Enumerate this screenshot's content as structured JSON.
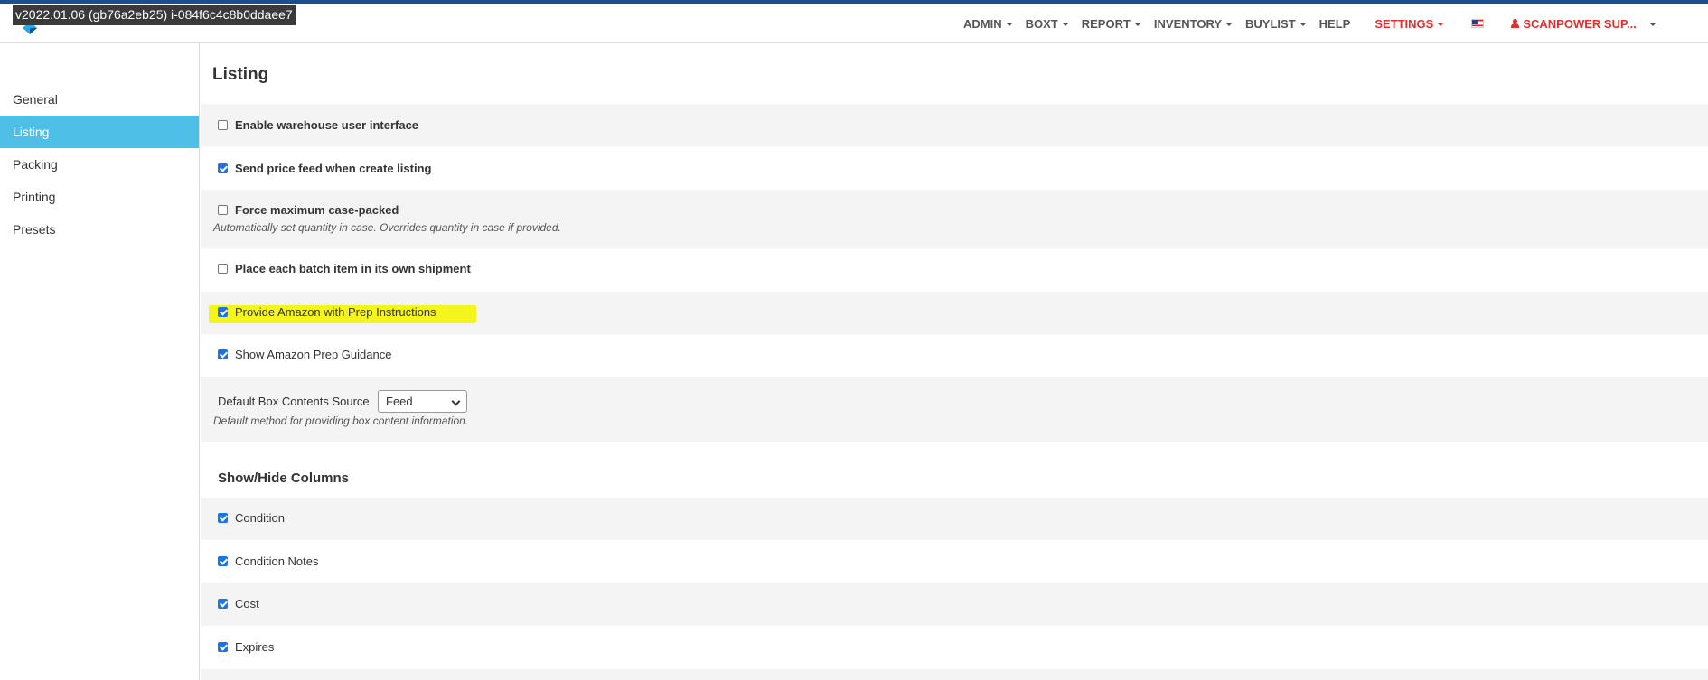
{
  "app": {
    "version": "v2022.01.06 (gb76a2eb25) i-084f6c4c8b0ddaee7"
  },
  "nav": {
    "items": [
      {
        "label": "ADMIN",
        "dropdown": true
      },
      {
        "label": "BOXT",
        "dropdown": true
      },
      {
        "label": "REPORT",
        "dropdown": true
      },
      {
        "label": "INVENTORY",
        "dropdown": true
      },
      {
        "label": "BUYLIST",
        "dropdown": true
      },
      {
        "label": "HELP",
        "dropdown": false
      },
      {
        "label": "SETTINGS",
        "dropdown": true,
        "active": true
      }
    ],
    "flag_icon": "us-flag-icon",
    "user_label": "SCANPOWER SUP...",
    "accent_color": "#e03030"
  },
  "sidebar": {
    "items": [
      {
        "label": "General",
        "active": false
      },
      {
        "label": "Listing",
        "active": true
      },
      {
        "label": "Packing",
        "active": false
      },
      {
        "label": "Printing",
        "active": false
      },
      {
        "label": "Presets",
        "active": false
      }
    ],
    "active_color": "#4ec0e8"
  },
  "main": {
    "title": "Listing",
    "options": [
      {
        "label": "Enable warehouse user interface",
        "checked": false
      },
      {
        "label": "Send price feed when create listing",
        "checked": true
      },
      {
        "label": "Force maximum case-packed",
        "checked": false,
        "help": "Automatically set quantity in case. Overrides quantity in case if provided."
      },
      {
        "label": "Place each batch item in its own shipment",
        "checked": false
      },
      {
        "label": "Provide Amazon with Prep Instructions",
        "checked": true,
        "highlighted": true
      },
      {
        "label": "Show Amazon Prep Guidance",
        "checked": true
      }
    ],
    "box_contents": {
      "label": "Default Box Contents Source",
      "value": "Feed",
      "help": "Default method for providing box content information."
    },
    "columns_section": {
      "title": "Show/Hide Columns",
      "items": [
        {
          "label": "Condition",
          "checked": true
        },
        {
          "label": "Condition Notes",
          "checked": true
        },
        {
          "label": "Cost",
          "checked": true
        },
        {
          "label": "Expires",
          "checked": true
        }
      ]
    },
    "highlight_color": "#f5f51e"
  }
}
